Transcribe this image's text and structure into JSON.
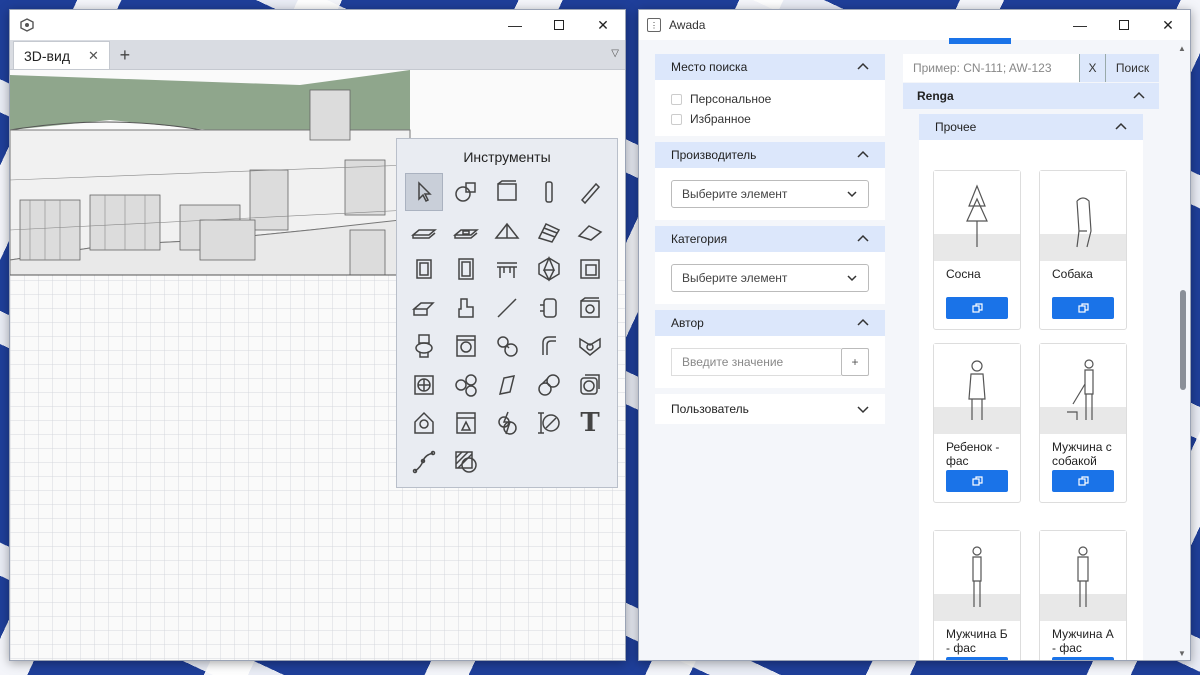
{
  "viewer_window": {
    "app_icon": "renga-logo-icon",
    "tab_label": "3D-вид",
    "tab_close": "✕",
    "add_tab": "+",
    "tab_menu": "▽",
    "controls": {
      "minimize": "—",
      "close": "✕"
    },
    "tools_title": "Инструменты",
    "tools": [
      "select-arrow-icon",
      "style-icon",
      "room-icon",
      "column-icon",
      "pencil-icon",
      "floor-icon",
      "slab-icon",
      "roof-icon",
      "stair-icon",
      "ramp-icon",
      "window-icon",
      "door-icon",
      "table-icon",
      "polyhedron-icon",
      "opening-icon",
      "beam-icon",
      "equipment-icon",
      "line-icon",
      "pipe-fitting-icon",
      "fixture-icon",
      "toilet-icon",
      "washing-machine-icon",
      "pipe-accessory-icon",
      "pipe-icon",
      "valve-icon",
      "fan-icon",
      "duct-fitting-icon",
      "duct-icon",
      "duct-accessory-icon",
      "socket-icon",
      "light-icon",
      "panel-icon",
      "electric-icon",
      "dimension-icon",
      "text-icon",
      "route-icon",
      "hatch-icon"
    ],
    "text_tool_glyph": "T"
  },
  "awada_window": {
    "title": "Awada",
    "controls": {
      "minimize": "—",
      "close": "✕"
    },
    "filters": {
      "search_place": {
        "label": "Место поиска",
        "options": [
          "Персональное",
          "Избранное"
        ]
      },
      "manufacturer": {
        "label": "Производитель",
        "placeholder": "Выберите элемент"
      },
      "category": {
        "label": "Категория",
        "placeholder": "Выберите элемент"
      },
      "author": {
        "label": "Автор",
        "placeholder": "Введите значение",
        "add": "+"
      },
      "user": {
        "label": "Пользователь"
      }
    },
    "search": {
      "placeholder": "Пример: CN-111; AW-123",
      "clear": "X",
      "submit": "Поиск"
    },
    "group": "Renga",
    "subgroup": "Прочее",
    "items": [
      {
        "name": "Сосна",
        "icon": "tree-icon"
      },
      {
        "name": "Собака",
        "icon": "dog-icon"
      },
      {
        "name": "Ребенок - фас",
        "icon": "child-icon"
      },
      {
        "name": "Мужчина с собакой",
        "icon": "man-with-dog-icon"
      },
      {
        "name": "Мужчина Б - фас",
        "icon": "man-b-icon"
      },
      {
        "name": "Мужчина А - фас",
        "icon": "man-a-icon"
      }
    ]
  }
}
